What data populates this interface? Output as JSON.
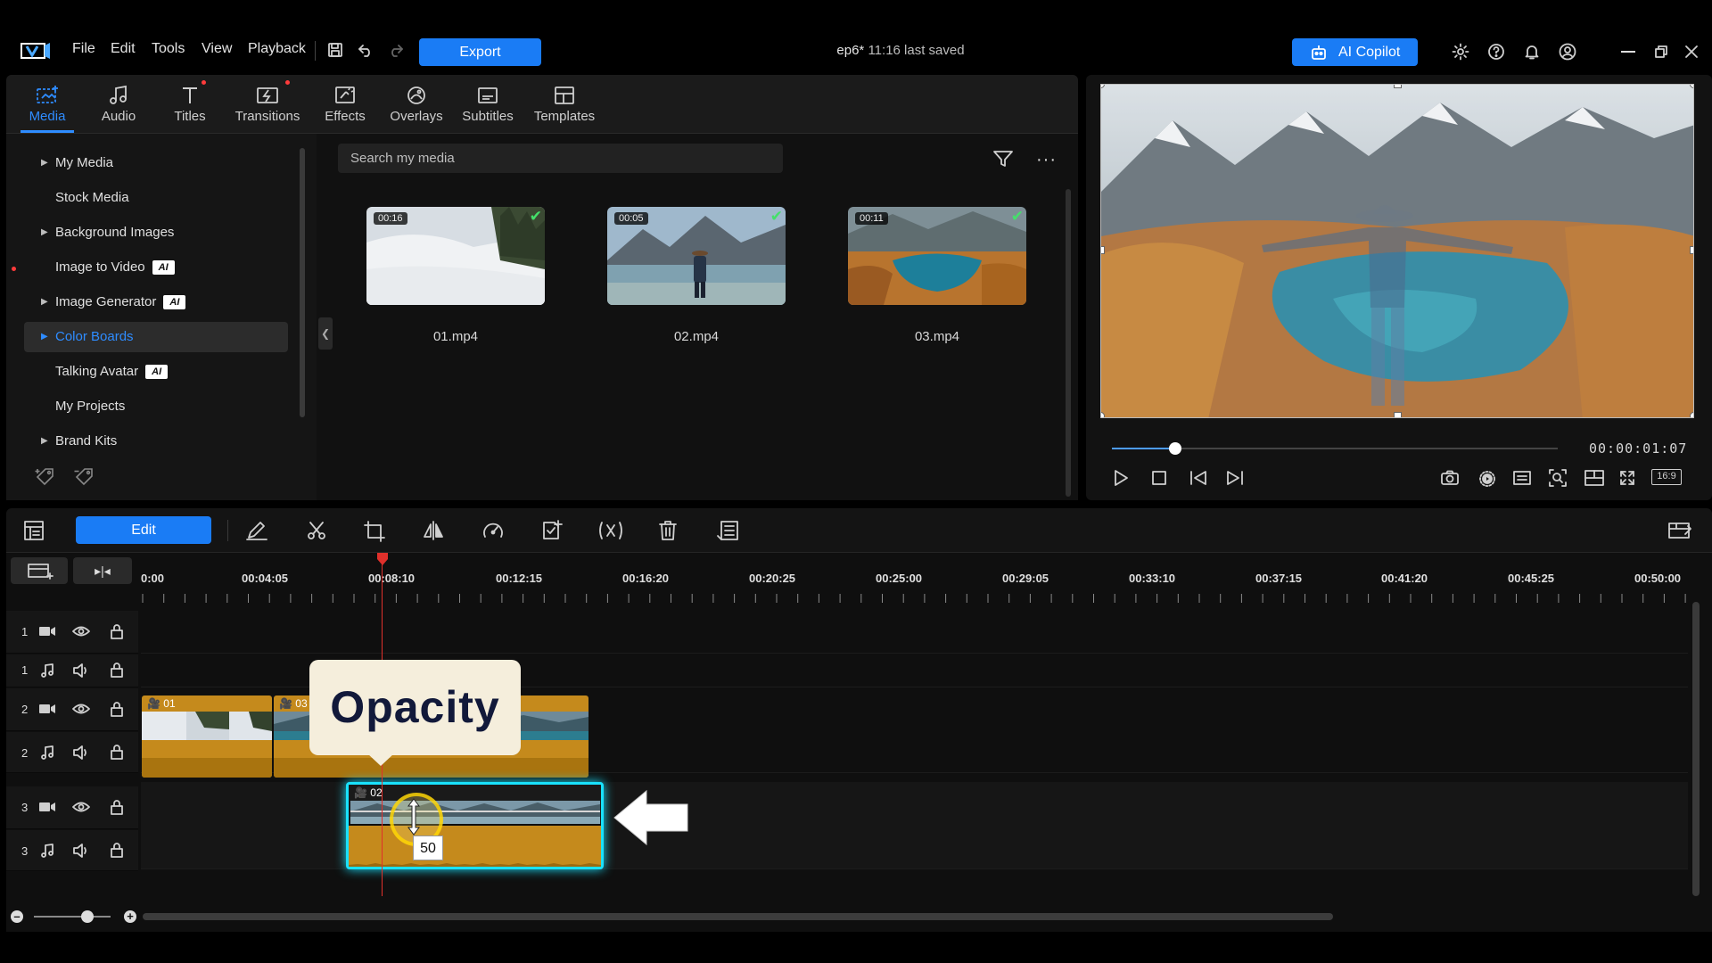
{
  "menu": [
    "File",
    "Edit",
    "Tools",
    "View",
    "Playback"
  ],
  "export_label": "Export",
  "project": {
    "name": "ep6*",
    "status": "11:16 last saved"
  },
  "copilot_label": "AI Copilot",
  "tabs": [
    "Media",
    "Audio",
    "Titles",
    "Transitions",
    "Effects",
    "Overlays",
    "Subtitles",
    "Templates"
  ],
  "tree": [
    {
      "label": "My Media",
      "arrow": true,
      "ai": false
    },
    {
      "label": "Stock Media",
      "arrow": false,
      "ai": false
    },
    {
      "label": "Background Images",
      "arrow": true,
      "ai": false
    },
    {
      "label": "Image to Video",
      "arrow": false,
      "ai": true
    },
    {
      "label": "Image Generator",
      "arrow": true,
      "ai": true
    },
    {
      "label": "Color Boards",
      "arrow": true,
      "ai": false
    },
    {
      "label": "Talking Avatar",
      "arrow": false,
      "ai": true
    },
    {
      "label": "My Projects",
      "arrow": false,
      "ai": false
    },
    {
      "label": "Brand Kits",
      "arrow": true,
      "ai": false
    }
  ],
  "ai_badge": "AI",
  "search_placeholder": "Search my media",
  "media": [
    {
      "name": "01.mp4",
      "duration": "00:16"
    },
    {
      "name": "02.mp4",
      "duration": "00:05"
    },
    {
      "name": "03.mp4",
      "duration": "00:11"
    }
  ],
  "preview": {
    "timecode": "00:00:01:07",
    "aspect": "16:9",
    "progress": 0.14
  },
  "edit_label": "Edit",
  "ruler": [
    "0:00",
    "00:04:05",
    "00:08:10",
    "00:12:15",
    "00:16:20",
    "00:20:25",
    "00:25:00",
    "00:29:05",
    "00:33:10",
    "00:37:15",
    "00:41:20",
    "00:45:25",
    "00:50:00"
  ],
  "tracks": [
    "1",
    "1",
    "2",
    "2",
    "3",
    "3"
  ],
  "clips": {
    "c1": "01",
    "c2": "03",
    "c3": "02"
  },
  "opacity_title": "Opacity",
  "opacity_value": "50",
  "colors": {
    "accent": "#1a7cf5",
    "clip": "#c58a1c",
    "selection": "#19e2ff",
    "playhead": "#e0302b"
  }
}
